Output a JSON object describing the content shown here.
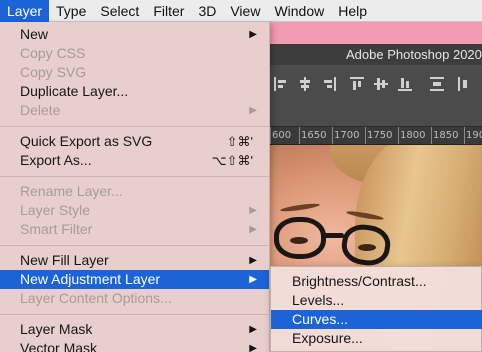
{
  "menubar": {
    "items": [
      "Layer",
      "Type",
      "Select",
      "Filter",
      "3D",
      "View",
      "Window",
      "Help"
    ],
    "active": "Layer"
  },
  "photoshop": {
    "title": "Adobe Photoshop 2020",
    "ruler_numbers": [
      "600",
      "1650",
      "1700",
      "1750",
      "1800",
      "1850",
      "190"
    ]
  },
  "layer_menu": {
    "new": "New",
    "copy_css": "Copy CSS",
    "copy_svg": "Copy SVG",
    "duplicate_layer": "Duplicate Layer...",
    "delete": "Delete",
    "quick_export": "Quick Export as SVG",
    "quick_export_shortcut": "⇧⌘'",
    "export_as": "Export As...",
    "export_as_shortcut": "⌥⇧⌘'",
    "rename_layer": "Rename Layer...",
    "layer_style": "Layer Style",
    "smart_filter": "Smart Filter",
    "new_fill_layer": "New Fill Layer",
    "new_adjustment_layer": "New Adjustment Layer",
    "layer_content_options": "Layer Content Options...",
    "layer_mask": "Layer Mask",
    "vector_mask": "Vector Mask",
    "submenu_arrow": "▶"
  },
  "adjustment_submenu": {
    "brightness_contrast": "Brightness/Contrast...",
    "levels": "Levels...",
    "curves": "Curves...",
    "exposure": "Exposure..."
  },
  "colors": {
    "highlight": "#1c63d8",
    "title_bar_pink": "#f29ab3"
  }
}
